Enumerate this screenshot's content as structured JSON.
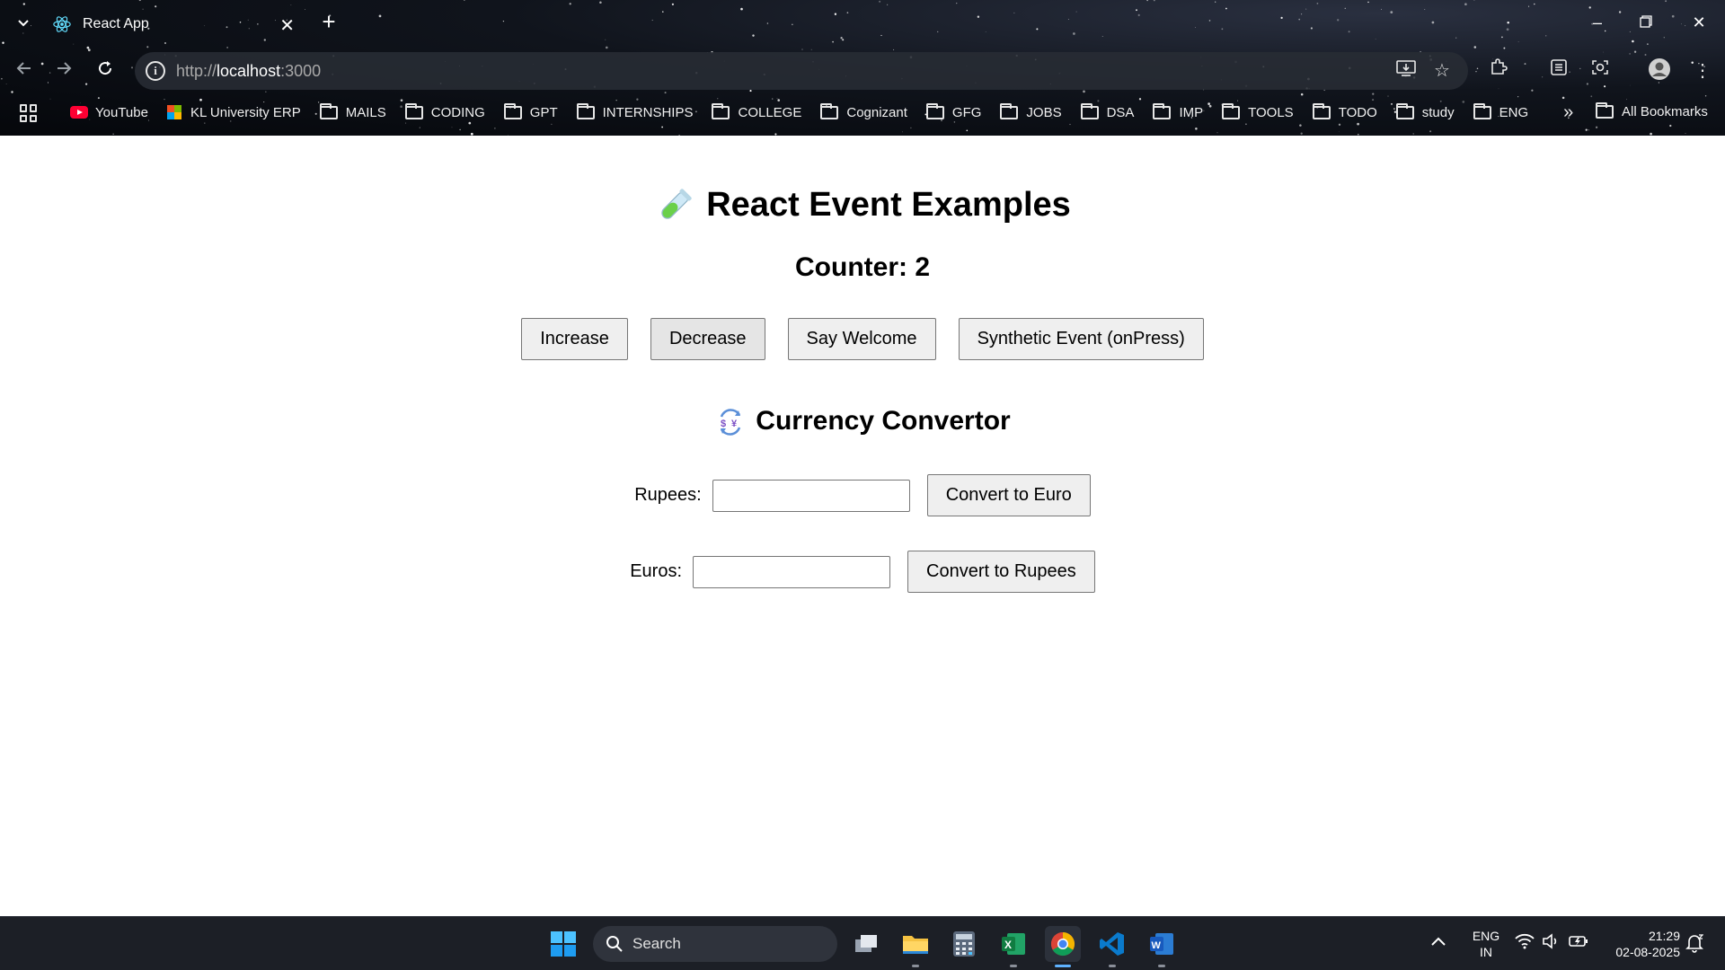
{
  "browser": {
    "tab_title": "React App",
    "url_proto": "http://",
    "url_host": "localhost",
    "url_port": ":3000"
  },
  "bookmarks": {
    "items": [
      {
        "label": "YouTube",
        "type": "youtube"
      },
      {
        "label": "KL University ERP",
        "type": "ms"
      },
      {
        "label": "MAILS",
        "type": "folder"
      },
      {
        "label": "CODING",
        "type": "folder"
      },
      {
        "label": "GPT",
        "type": "folder"
      },
      {
        "label": "INTERNSHIPS",
        "type": "folder"
      },
      {
        "label": "COLLEGE",
        "type": "folder"
      },
      {
        "label": "Cognizant",
        "type": "folder"
      },
      {
        "label": "GFG",
        "type": "folder"
      },
      {
        "label": "JOBS",
        "type": "folder"
      },
      {
        "label": "DSA",
        "type": "folder"
      },
      {
        "label": "IMP",
        "type": "folder"
      },
      {
        "label": "TOOLS",
        "type": "folder"
      },
      {
        "label": "TODO",
        "type": "folder"
      },
      {
        "label": "study",
        "type": "folder"
      },
      {
        "label": "ENG",
        "type": "folder"
      }
    ],
    "overflow": "»",
    "all_bookmarks": "All Bookmarks"
  },
  "page": {
    "title": "React Event Examples",
    "counter_label": "Counter: 2",
    "buttons": {
      "increase": "Increase",
      "decrease": "Decrease",
      "say_welcome": "Say Welcome",
      "synthetic": "Synthetic Event (onPress)"
    },
    "currency": {
      "title": "Currency Convertor",
      "rupees_label": "Rupees:",
      "rupees_value": "",
      "convert_to_euro": "Convert to Euro",
      "euros_label": "Euros:",
      "euros_value": "",
      "convert_to_rupees": "Convert to Rupees"
    }
  },
  "taskbar": {
    "search_label": "Search",
    "lang_line1": "ENG",
    "lang_line2": "IN",
    "time": "21:29",
    "date": "02-08-2025"
  },
  "colors": {
    "accent_blue": "#5fb2ff",
    "youtube_red": "#ff0033"
  }
}
